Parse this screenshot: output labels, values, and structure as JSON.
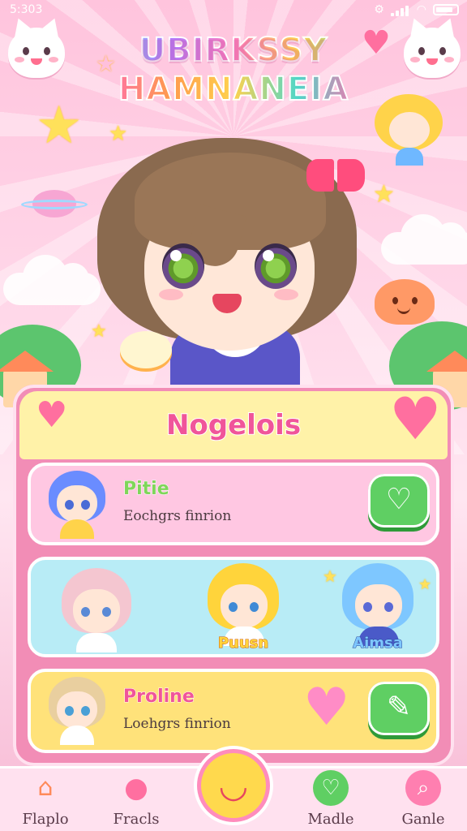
{
  "status_bar": {
    "time": "5:303",
    "gear_icon": "settings-icon",
    "wifi_icon": "wifi-icon",
    "battery_icon": "battery-icon"
  },
  "logo": {
    "line1": "UBIRKSSY",
    "line2": "HAMNANEIA"
  },
  "card": {
    "title": "Nogelois",
    "rows": [
      {
        "name": "Pitie",
        "subtitle": "Eochgrs finrion",
        "action_icon": "heart-icon"
      },
      {
        "characters": [
          {
            "label": ""
          },
          {
            "label": "Puusn"
          },
          {
            "label": "Aimsa"
          }
        ]
      },
      {
        "name": "Proline",
        "subtitle": "Loehgrs finrion",
        "action_icon": "wand-icon"
      }
    ]
  },
  "nav": {
    "items": [
      {
        "label": "Flaplo",
        "icon": "house-icon"
      },
      {
        "label": "Fracls",
        "icon": "slime-friends-icon"
      },
      {
        "label": "",
        "icon": "smile-center-icon"
      },
      {
        "label": "Madle",
        "icon": "heart-icon"
      },
      {
        "label": "Ganle",
        "icon": "search-icon"
      }
    ]
  },
  "colors": {
    "accent_pink": "#f0559a",
    "card_pink": "#f28db6",
    "button_green": "#5fcf63",
    "highlight_yellow": "#fff2a8"
  }
}
